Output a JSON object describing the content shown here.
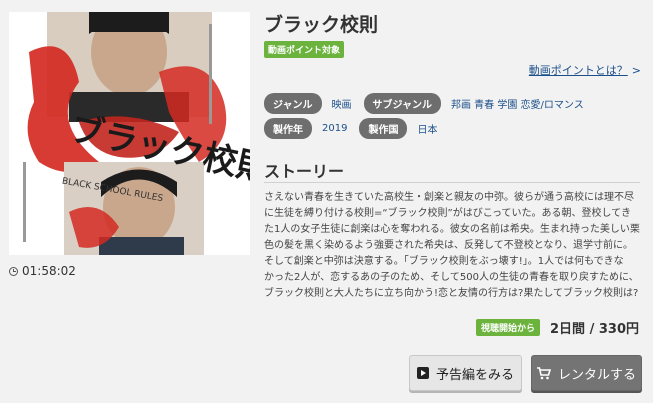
{
  "movie": {
    "title": "ブラック校則",
    "point_badge": "動画ポイント対象",
    "point_link": "動画ポイントとは？",
    "duration": "01:58:02",
    "poster": {
      "title_art": "ブラック校則",
      "subtitle_art": "BLACK SCHOOL RULES"
    }
  },
  "meta": {
    "genre_label": "ジャンル",
    "genre_value": "映画",
    "subgenre_label": "サブジャンル",
    "subgenre_value": "邦画 青春 学園 恋愛/ロマンス",
    "year_label": "製作年",
    "year_value": "2019",
    "country_label": "製作国",
    "country_value": "日本"
  },
  "story": {
    "heading": "ストーリー",
    "text": "さえない青春を生きていた高校生・創楽と親友の中弥。彼らが通う高校には理不尽\nに生徒を縛り付ける校則=“ブラック校則”がはびこっていた。ある朝、登校してき\nた1人の女子生徒に創楽は心を奪われる。彼女の名前は希央。生まれ持った美しい栗\n色の髪を黒く染めるよう強要された希央は、反発して不登校となり、退学寸前に。\nそして創楽と中弥は決意する。「ブラック校則をぶっ壊す!」。1人では何もできな\nかった2人が、恋するあの子のため、そして500人の生徒の青春を取り戻すために、\nブラック校則と大人たちに立ち向かう!恋と友情の行方は?果たしてブラック校則は?"
  },
  "pricing": {
    "start_badge": "視聴開始から",
    "price": "2日間 / 330円"
  },
  "buttons": {
    "trailer": "予告編をみる",
    "rental": "レンタルする"
  },
  "colors": {
    "accent_green": "#6cb33e",
    "pill_gray": "#6e6e6e",
    "link_blue": "#1b4f8a",
    "poster_red": "#d42a22"
  }
}
